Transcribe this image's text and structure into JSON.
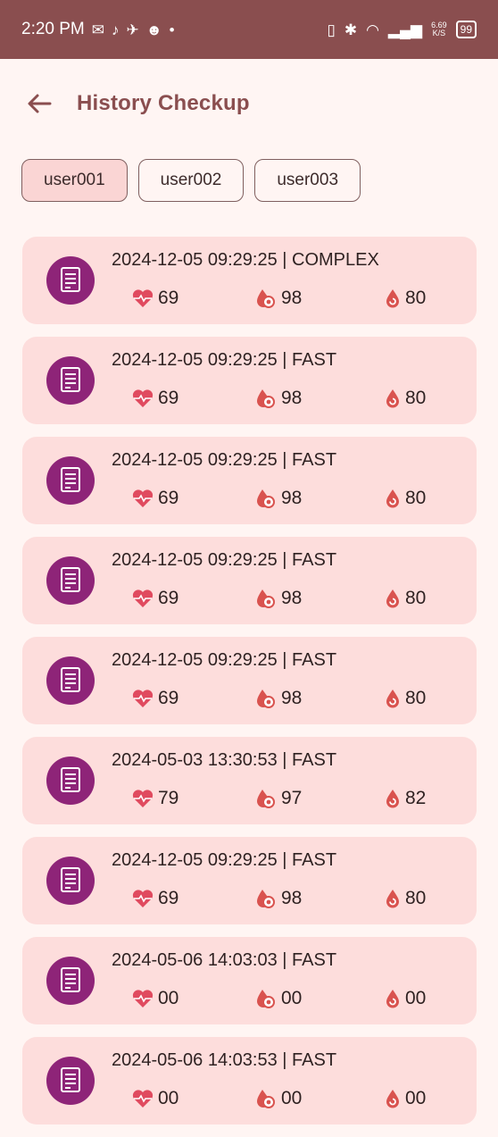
{
  "status_bar": {
    "time": "2:20 PM",
    "net_speed_top": "6.69",
    "net_speed_bottom": "K/S",
    "battery": "99"
  },
  "app_bar": {
    "title": "History Checkup"
  },
  "users": [
    {
      "label": "user001",
      "selected": true
    },
    {
      "label": "user002",
      "selected": false
    },
    {
      "label": "user003",
      "selected": false
    }
  ],
  "records": [
    {
      "title": "2024-12-05 09:29:25 | COMPLEX",
      "heart": "69",
      "spo2": "98",
      "bp": "80"
    },
    {
      "title": "2024-12-05 09:29:25 | FAST",
      "heart": "69",
      "spo2": "98",
      "bp": "80"
    },
    {
      "title": "2024-12-05 09:29:25 | FAST",
      "heart": "69",
      "spo2": "98",
      "bp": "80"
    },
    {
      "title": "2024-12-05 09:29:25 | FAST",
      "heart": "69",
      "spo2": "98",
      "bp": "80"
    },
    {
      "title": "2024-12-05 09:29:25 | FAST",
      "heart": "69",
      "spo2": "98",
      "bp": "80"
    },
    {
      "title": "2024-05-03 13:30:53 | FAST",
      "heart": "79",
      "spo2": "97",
      "bp": "82"
    },
    {
      "title": "2024-12-05 09:29:25 | FAST",
      "heart": "69",
      "spo2": "98",
      "bp": "80"
    },
    {
      "title": "2024-05-06 14:03:03 | FAST",
      "heart": "00",
      "spo2": "00",
      "bp": "00"
    },
    {
      "title": "2024-05-06 14:03:53 | FAST",
      "heart": "00",
      "spo2": "00",
      "bp": "00"
    }
  ],
  "colors": {
    "status_bar": "#8A4E4F",
    "accent": "#8A4E4F",
    "card_bg": "#FDDDDC",
    "chip_selected": "#FAD5D4",
    "icon_bg": "#8E2478",
    "heart": "#E04A5F",
    "drop": "#D9534F"
  },
  "icons": {
    "back": "arrow-left-icon",
    "record": "document-icon",
    "heart": "heart-pulse-icon",
    "spo2": "oxygen-drop-icon",
    "bp": "blood-drop-icon"
  }
}
